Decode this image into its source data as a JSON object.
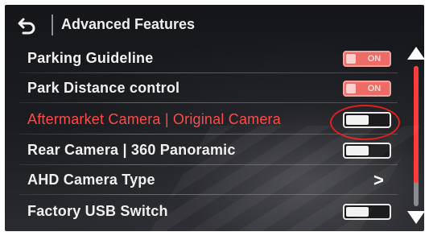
{
  "header": {
    "title": "Advanced Features",
    "back_icon": "back-arrow-icon"
  },
  "settings": [
    {
      "label": "Parking Guideline",
      "control": "toggle",
      "state": "on",
      "on_text": "ON"
    },
    {
      "label": "Park Distance control",
      "control": "toggle",
      "state": "on",
      "on_text": "ON"
    },
    {
      "label": "Aftermarket Camera | Original Camera",
      "control": "toggle",
      "state": "off",
      "highlighted": true
    },
    {
      "label": "Rear Camera | 360 Panoramic",
      "control": "toggle",
      "state": "off"
    },
    {
      "label": "AHD Camera Type",
      "control": "chevron",
      "chevron": ">"
    },
    {
      "label": "Factory USB Switch",
      "control": "toggle",
      "state": "off"
    }
  ],
  "scrollbar": {
    "up_icon": "triangle-up-icon",
    "down_icon": "triangle-down-icon",
    "position": 0.0,
    "visible_fraction": 0.83
  },
  "colors": {
    "accent": "#ff4a4a",
    "toggle_on": "#ee6b66",
    "text": "#f0f0f0",
    "background": "#1c1d21",
    "highlight_ring": "#e02020"
  }
}
